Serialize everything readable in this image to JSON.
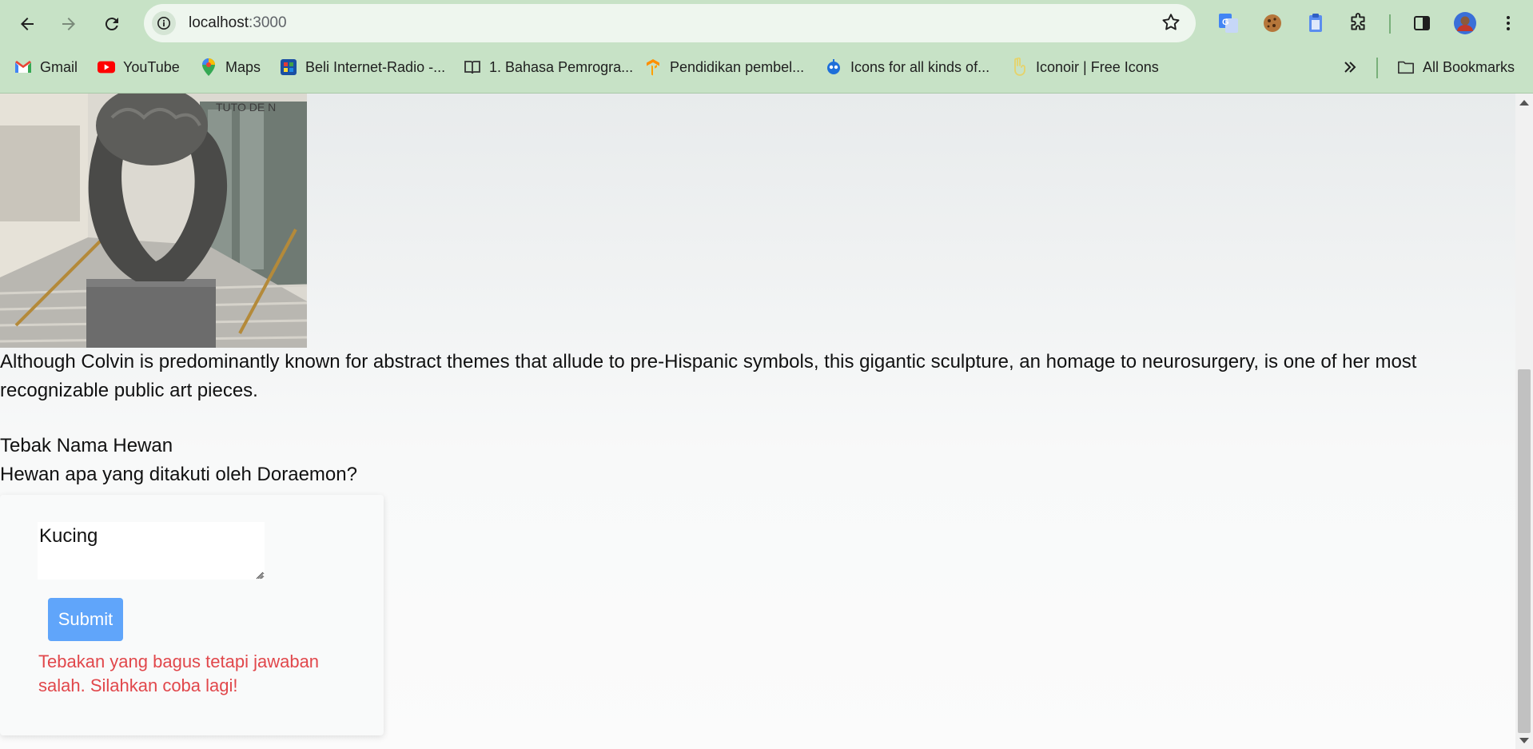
{
  "browser": {
    "url_host": "localhost",
    "url_port": ":3000",
    "bookmarks": [
      {
        "label": "Gmail",
        "icon": "gmail-icon"
      },
      {
        "label": "YouTube",
        "icon": "youtube-icon"
      },
      {
        "label": "Maps",
        "icon": "maps-icon"
      },
      {
        "label": "Beli Internet-Radio -...",
        "icon": "radio-site-icon"
      },
      {
        "label": "1. Bahasa Pemrogra...",
        "icon": "book-icon"
      },
      {
        "label": "Pendidikan pembel...",
        "icon": "tensorflow-icon"
      },
      {
        "label": "Icons for all kinds of...",
        "icon": "robot-icon"
      },
      {
        "label": "Iconoir | Free Icons",
        "icon": "peace-hand-icon"
      }
    ],
    "all_bookmarks": "All Bookmarks"
  },
  "content": {
    "caption": "Although Colvin is predominantly known for abstract themes that allude to pre-Hispanic symbols, this gigantic sculpture, an homage to neurosurgery, is one of her most recognizable public art pieces.",
    "quiz_title": "Tebak Nama Hewan",
    "question": "Hewan apa yang ditakuti oleh Doraemon?",
    "answer_value": "Kucing",
    "submit_label": "Submit",
    "feedback": "Tebakan yang bagus tetapi jawaban salah. Silahkan coba lagi!"
  },
  "colors": {
    "chrome_bg": "#c7e2c6",
    "submit_bg": "#60a5fa",
    "error_text": "#e1474b"
  }
}
